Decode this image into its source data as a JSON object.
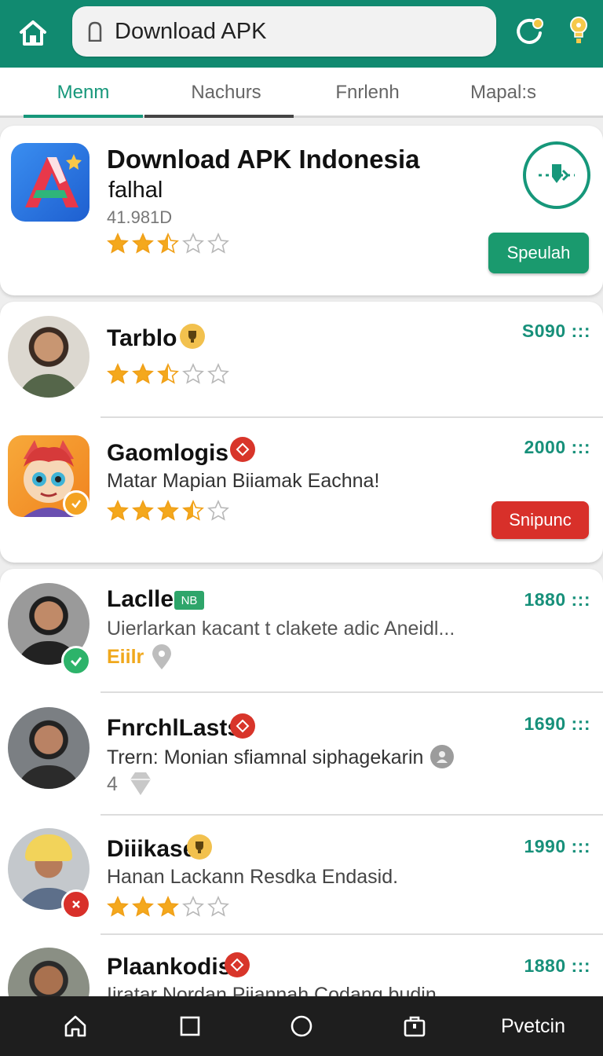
{
  "browser": {
    "url_text": "Download APK",
    "colors": {
      "bar": "#118a70",
      "accent": "#16977a"
    }
  },
  "tabs": [
    {
      "label": "Menm",
      "active": true
    },
    {
      "label": "Nachurs",
      "active": false
    },
    {
      "label": "Fnrlenh",
      "active": false
    },
    {
      "label": "Mapal:s",
      "active": false
    }
  ],
  "featured": {
    "title_line1": "Download APK Indonesia",
    "title_line2": "falhal",
    "size": "41.981D",
    "rating": 2.5,
    "install_label": "Speulah"
  },
  "items": [
    {
      "name": "Tarblo",
      "price": "S090 :::",
      "rating": 2.5
    },
    {
      "name": "Gaomlogis",
      "desc": "Matar Mapian Biiamak Eachna!",
      "price": "2000 :::",
      "rating": 3.5,
      "button": "Snipunc"
    },
    {
      "name": "Laclle",
      "tag": "NB",
      "desc": "Uierlarkan kacant t clakete adic Aneidl...",
      "meta": "Eiilr",
      "price": "1880 :::"
    },
    {
      "name": "FnrchlLasts",
      "desc": "Trern: Monian sfiamnal siphagekarin",
      "meta": "4",
      "price": "1690 :::"
    },
    {
      "name": "Diiikase",
      "desc": "Hanan Lackann Resdka Endasid.",
      "price": "1990 :::",
      "rating": 3
    },
    {
      "name": "Plaankodis",
      "desc": "Iiratar Nordan Pijannah Codang budin",
      "price": "1880 :::"
    }
  ],
  "bottom_nav": {
    "label": "Pvetcin"
  }
}
